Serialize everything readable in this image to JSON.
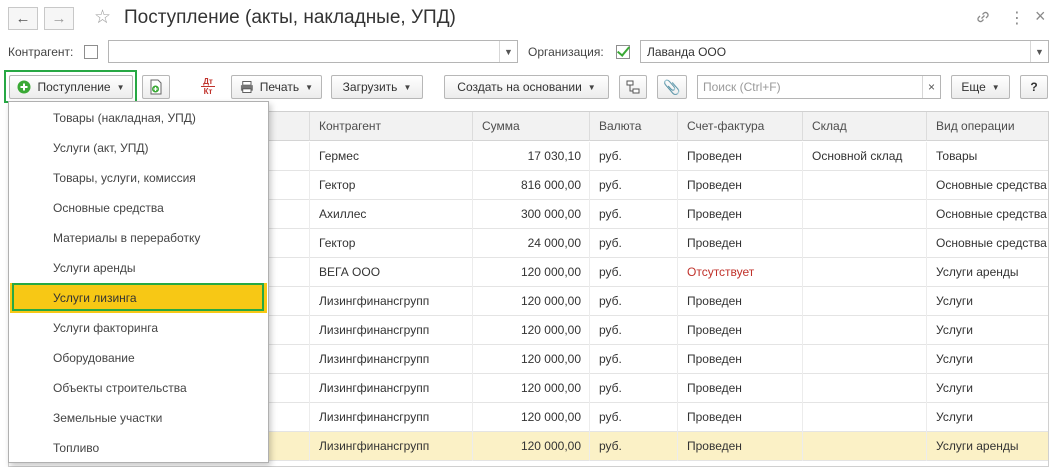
{
  "window": {
    "title": "Поступление (акты, накладные, УПД)",
    "back_icon": "arrow-left",
    "forward_icon": "arrow-right",
    "favorite_icon": "star",
    "link_icon": "link",
    "menu_icon": "more-vertical",
    "close_icon": "close"
  },
  "filters": {
    "counterparty_label": "Контрагент:",
    "counterparty_checked": false,
    "counterparty_value": "",
    "organization_label": "Организация:",
    "organization_checked": true,
    "organization_value": "Лаванда ООО"
  },
  "toolbar": {
    "receipt_label": "Поступление",
    "print_label": "Печать",
    "upload_label": "Загрузить",
    "create_based_label": "Создать на основании",
    "search_placeholder": "Поиск (Ctrl+F)",
    "search_clear": "×",
    "more_label": "Еще",
    "help_label": "?",
    "dtkt_top": "Дт",
    "dtkt_bottom": "Кт"
  },
  "menu": {
    "items": [
      "Товары (накладная, УПД)",
      "Услуги (акт, УПД)",
      "Товары, услуги, комиссия",
      "Основные средства",
      "Материалы в переработку",
      "Услуги аренды",
      "Услуги лизинга",
      "Услуги факторинга",
      "Оборудование",
      "Объекты строительства",
      "Земельные участки",
      "Топливо"
    ],
    "active_index": 6
  },
  "table": {
    "columns": [
      "Контрагент",
      "Сумма",
      "Валюта",
      "Счет-фактура",
      "Склад",
      "Вид операции"
    ],
    "rows": [
      {
        "contractor": "Гермес",
        "sum": "17 030,10",
        "currency": "руб.",
        "invoice": "Проведен",
        "warehouse": "Основной склад",
        "operation": "Товары"
      },
      {
        "contractor": "Гектор",
        "sum": "816 000,00",
        "currency": "руб.",
        "invoice": "Проведен",
        "warehouse": "",
        "operation": "Основные средства"
      },
      {
        "contractor": "Ахиллес",
        "sum": "300 000,00",
        "currency": "руб.",
        "invoice": "Проведен",
        "warehouse": "",
        "operation": "Основные средства"
      },
      {
        "contractor": "Гектор",
        "sum": "24 000,00",
        "currency": "руб.",
        "invoice": "Проведен",
        "warehouse": "",
        "operation": "Основные средства"
      },
      {
        "contractor": "ВЕГА ООО",
        "sum": "120 000,00",
        "currency": "руб.",
        "invoice": "Отсутствует",
        "warehouse": "",
        "operation": "Услуги аренды"
      },
      {
        "contractor": "Лизингфинансгрупп",
        "sum": "120 000,00",
        "currency": "руб.",
        "invoice": "Проведен",
        "warehouse": "",
        "operation": "Услуги"
      },
      {
        "contractor": "Лизингфинансгрупп",
        "sum": "120 000,00",
        "currency": "руб.",
        "invoice": "Проведен",
        "warehouse": "",
        "operation": "Услуги"
      },
      {
        "contractor": "Лизингфинансгрупп",
        "sum": "120 000,00",
        "currency": "руб.",
        "invoice": "Проведен",
        "warehouse": "",
        "operation": "Услуги"
      },
      {
        "contractor": "Лизингфинансгрупп",
        "sum": "120 000,00",
        "currency": "руб.",
        "invoice": "Проведен",
        "warehouse": "",
        "operation": "Услуги"
      },
      {
        "contractor": "Лизингфинансгрупп",
        "sum": "120 000,00",
        "currency": "руб.",
        "invoice": "Проведен",
        "warehouse": "",
        "operation": "Услуги"
      },
      {
        "contractor": "Лизингфинансгрупп",
        "sum": "120 000,00",
        "currency": "руб.",
        "invoice": "Проведен",
        "warehouse": "",
        "operation": "Услуги аренды"
      }
    ],
    "selected_row_index": 10,
    "missing_invoice_color": "#c0322b"
  },
  "colors": {
    "highlight_green": "#27a844",
    "menu_active": "#f7c815",
    "selected_row": "#fbf1c6"
  }
}
